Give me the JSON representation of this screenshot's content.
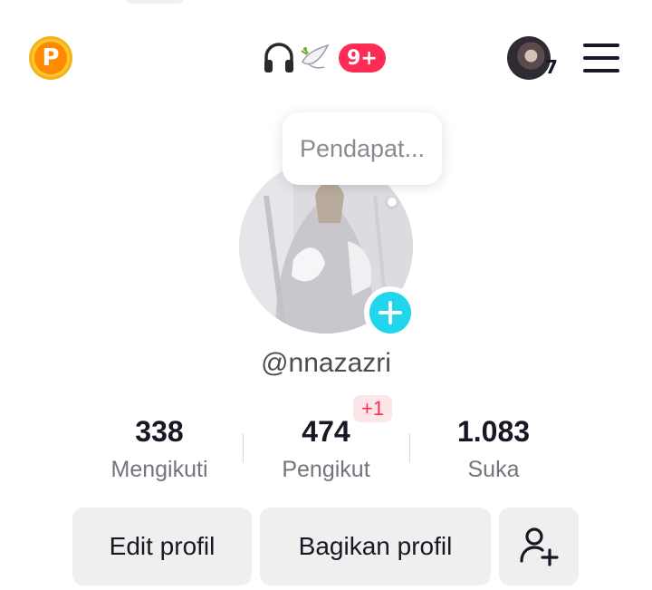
{
  "header": {
    "coin_letter": "P",
    "notification_badge": "9+",
    "account_count": "7"
  },
  "profile": {
    "note_text": "Pendapat...",
    "username": "@nnazazri"
  },
  "stats": [
    {
      "value": "338",
      "label": "Mengikuti"
    },
    {
      "value": "474",
      "label": "Pengikut",
      "increment": "+1"
    },
    {
      "value": "1.083",
      "label": "Suka"
    }
  ],
  "actions": {
    "edit_label": "Edit profil",
    "share_label": "Bagikan profil",
    "add_friend_icon": "add-person-icon"
  },
  "colors": {
    "accent_red": "#fe2c55",
    "add_cyan": "#20d5ec",
    "coin_orange": "#ff8a00"
  },
  "icons": [
    "coin-icon",
    "headphones-icon",
    "dove-icon",
    "menu-icon",
    "plus-icon",
    "add-person-icon"
  ]
}
